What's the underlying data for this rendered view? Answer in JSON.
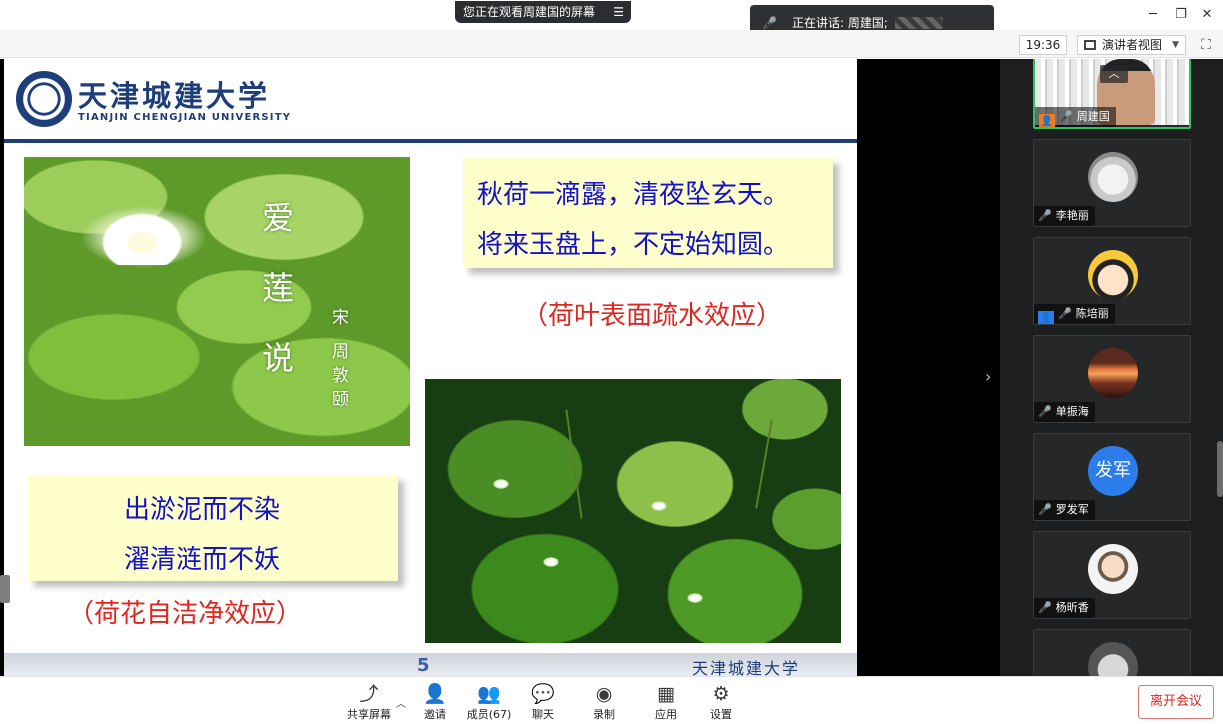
{
  "banner": {
    "viewing": "您正在观看周建国的屏幕",
    "speaking": "正在讲话: 周建国;"
  },
  "toolbar": {
    "clock": "19:36",
    "presenter_view": "演讲者视图"
  },
  "slide": {
    "logo_cn": "天津城建大学",
    "logo_en": "TIANJIN CHENGJIAN UNIVERSITY",
    "poem_title": [
      "爱",
      "莲",
      "说"
    ],
    "poem_author": [
      "宋",
      "周",
      "敦",
      "颐"
    ],
    "right_quote": [
      "秋荷一滴露，清夜坠玄天。",
      "将来玉盘上，不定始知圆。"
    ],
    "right_note": "（荷叶表面疏水效应）",
    "left_quote": [
      "出淤泥而不染",
      "濯清涟而不妖"
    ],
    "left_note": "（荷花自洁净效应）",
    "page_number": "5",
    "footer_logo": "天津城建大学"
  },
  "participants": [
    {
      "name": "周建国",
      "badge": "orange",
      "mic": "on",
      "video": true
    },
    {
      "name": "李艳丽",
      "badge": "",
      "mic": "muted"
    },
    {
      "name": "陈培丽",
      "badge": "blue",
      "mic": "muted"
    },
    {
      "name": "单振海",
      "badge": "",
      "mic": "muted"
    },
    {
      "name": "罗发军",
      "badge": "",
      "mic": "muted",
      "avatar_text": "发军"
    },
    {
      "name": "杨昕香",
      "badge": "",
      "mic": "muted"
    }
  ],
  "bottom_bar": {
    "share": "共享屏幕",
    "invite": "邀请",
    "members": "成员(67)",
    "chat": "聊天",
    "record": "录制",
    "apps": "应用",
    "settings": "设置",
    "leave": "离开会议"
  },
  "colors": {
    "brand_blue": "#1d3e7a",
    "quote_blue": "#1212c8",
    "note_red": "#e0261f",
    "quote_bg": "#ffffcc",
    "active_speaker": "#2ec45c"
  }
}
